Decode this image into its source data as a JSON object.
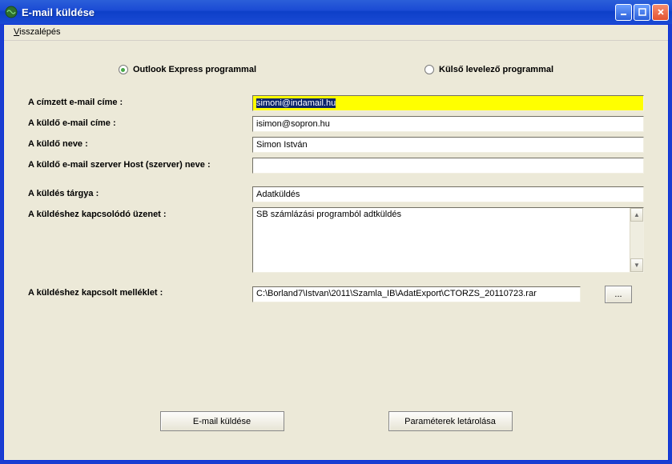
{
  "window": {
    "title": "E-mail küldése"
  },
  "menu": {
    "back": "Visszalépés"
  },
  "radios": {
    "outlook": "Outlook Express programmal",
    "external": "Külső levelező programmal"
  },
  "labels": {
    "recipient": "A címzett e-mail címe :",
    "sender_email": "A küldő e-mail címe :",
    "sender_name": "A küldő neve :",
    "smtp_host": "A küldő e-mail szerver Host (szerver) neve :",
    "subject": "A küldés tárgya :",
    "message": "A küldéshez kapcsolódó üzenet :",
    "attachment": "A küldéshez kapcsolt melléklet :"
  },
  "values": {
    "recipient": "simoni@indamail.hu",
    "sender_email": "isimon@sopron.hu",
    "sender_name": "Simon István",
    "smtp_host": "",
    "subject": "Adatküldés",
    "message": "SB számlázási programból adtküldés",
    "attachment": "C:\\Borland7\\Istvan\\2011\\Szamla_IB\\AdatExport\\CTORZS_20110723.rar"
  },
  "buttons": {
    "browse": "...",
    "send": "E-mail küldése",
    "save_params": "Paraméterek letárolása"
  }
}
